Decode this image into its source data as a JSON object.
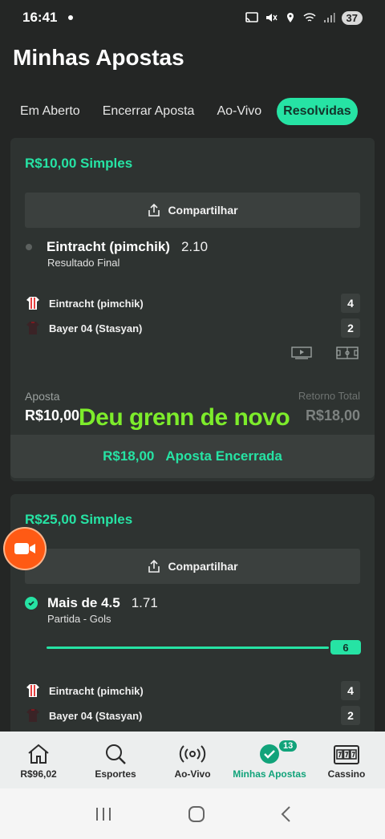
{
  "status_bar": {
    "time": "16:41",
    "battery": "37"
  },
  "page_title": "Minhas Apostas",
  "tabs": [
    {
      "label": "Em Aberto"
    },
    {
      "label": "Encerrar Aposta"
    },
    {
      "label": "Ao-Vivo"
    },
    {
      "label": "Resolvidas"
    }
  ],
  "bets": [
    {
      "title": "R$10,00 Simples",
      "share_label": "Compartilhar",
      "selection": "Eintracht (pimchik)",
      "odds": "2.10",
      "market": "Resultado Final",
      "teams": [
        {
          "name": "Eintracht (pimchik)",
          "score": "4"
        },
        {
          "name": "Bayer 04 (Stasyan)",
          "score": "2"
        }
      ],
      "stake_label": "Aposta",
      "stake_value": "R$10,00",
      "return_label": "Retorno Total",
      "return_value": "R$18,00",
      "closed_amount": "R$18,00",
      "closed_label": "Aposta Encerrada"
    },
    {
      "title": "R$25,00 Simples",
      "share_label": "Compartilhar",
      "selection": "Mais de 4.5",
      "odds": "1.71",
      "market": "Partida - Gols",
      "progress_value": "6",
      "teams": [
        {
          "name": "Eintracht (pimchik)",
          "score": "4"
        },
        {
          "name": "Bayer 04 (Stasyan)",
          "score": "2"
        }
      ]
    }
  ],
  "overlay_caption": "Deu grenn de novo",
  "bottom_nav": [
    {
      "label": "R$96,02",
      "icon": "home-icon"
    },
    {
      "label": "Esportes",
      "icon": "search-icon"
    },
    {
      "label": "Ao-Vivo",
      "icon": "live-icon"
    },
    {
      "label": "Minhas Apostas",
      "icon": "check-circle-icon",
      "badge": "13"
    },
    {
      "label": "Cassino",
      "icon": "slot-machine-icon"
    }
  ],
  "colors": {
    "accent": "#26e3a4",
    "background": "#242625",
    "card": "#2e3331",
    "caption": "#7dec2b",
    "record": "#ff5a14"
  }
}
